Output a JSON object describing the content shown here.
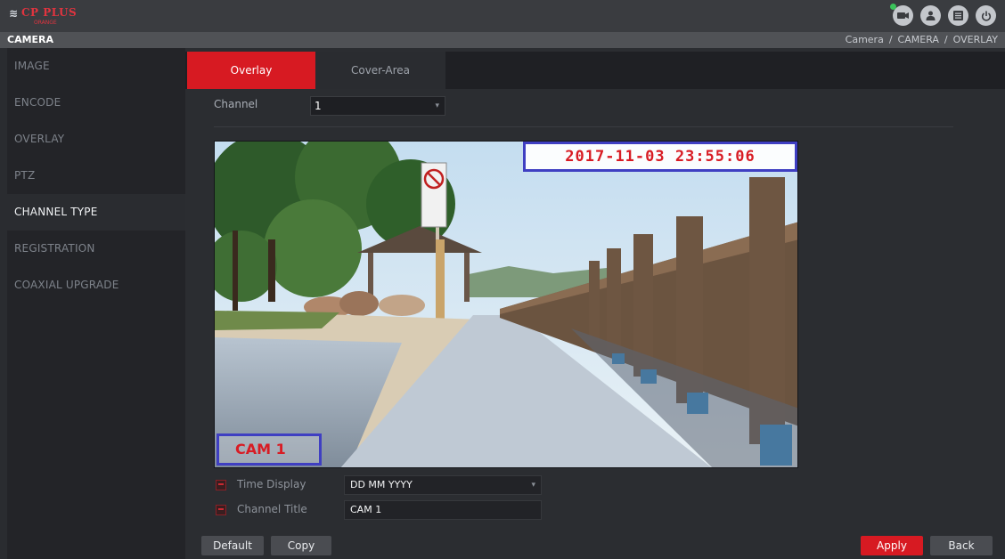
{
  "header": {
    "logo_mark": "≋",
    "logo_brand": "CP PLUS",
    "logo_sub": "ORANGE",
    "icons": [
      "camera-icon",
      "user-icon",
      "menu-icon",
      "power-icon"
    ]
  },
  "titlebar": {
    "title": "CAMERA",
    "breadcrumb": [
      "Camera",
      "CAMERA",
      "OVERLAY"
    ],
    "separator": "/"
  },
  "sidebar": {
    "items": [
      {
        "label": "IMAGE",
        "active": false
      },
      {
        "label": "ENCODE",
        "active": false
      },
      {
        "label": "OVERLAY",
        "active": false
      },
      {
        "label": "PTZ",
        "active": false
      },
      {
        "label": "CHANNEL TYPE",
        "active": true
      },
      {
        "label": "REGISTRATION",
        "active": false
      },
      {
        "label": "COAXIAL UPGRADE",
        "active": false
      }
    ]
  },
  "tabs": [
    {
      "label": "Overlay",
      "active": true
    },
    {
      "label": "Cover-Area",
      "active": false
    }
  ],
  "channel": {
    "label": "Channel",
    "value": "1"
  },
  "preview": {
    "timestamp": "2017-11-03 23:55:06",
    "camera_title": "CAM 1"
  },
  "settings": {
    "time_display": {
      "label": "Time Display",
      "value": "DD MM YYYY"
    },
    "channel_title": {
      "label": "Channel Title",
      "value": "CAM 1"
    }
  },
  "buttons": {
    "default": "Default",
    "copy": "Copy",
    "apply": "Apply",
    "back": "Back"
  },
  "colors": {
    "accent": "#d71a22",
    "overlay_border": "#3f3fc2",
    "overlay_text": "#d81c24"
  }
}
